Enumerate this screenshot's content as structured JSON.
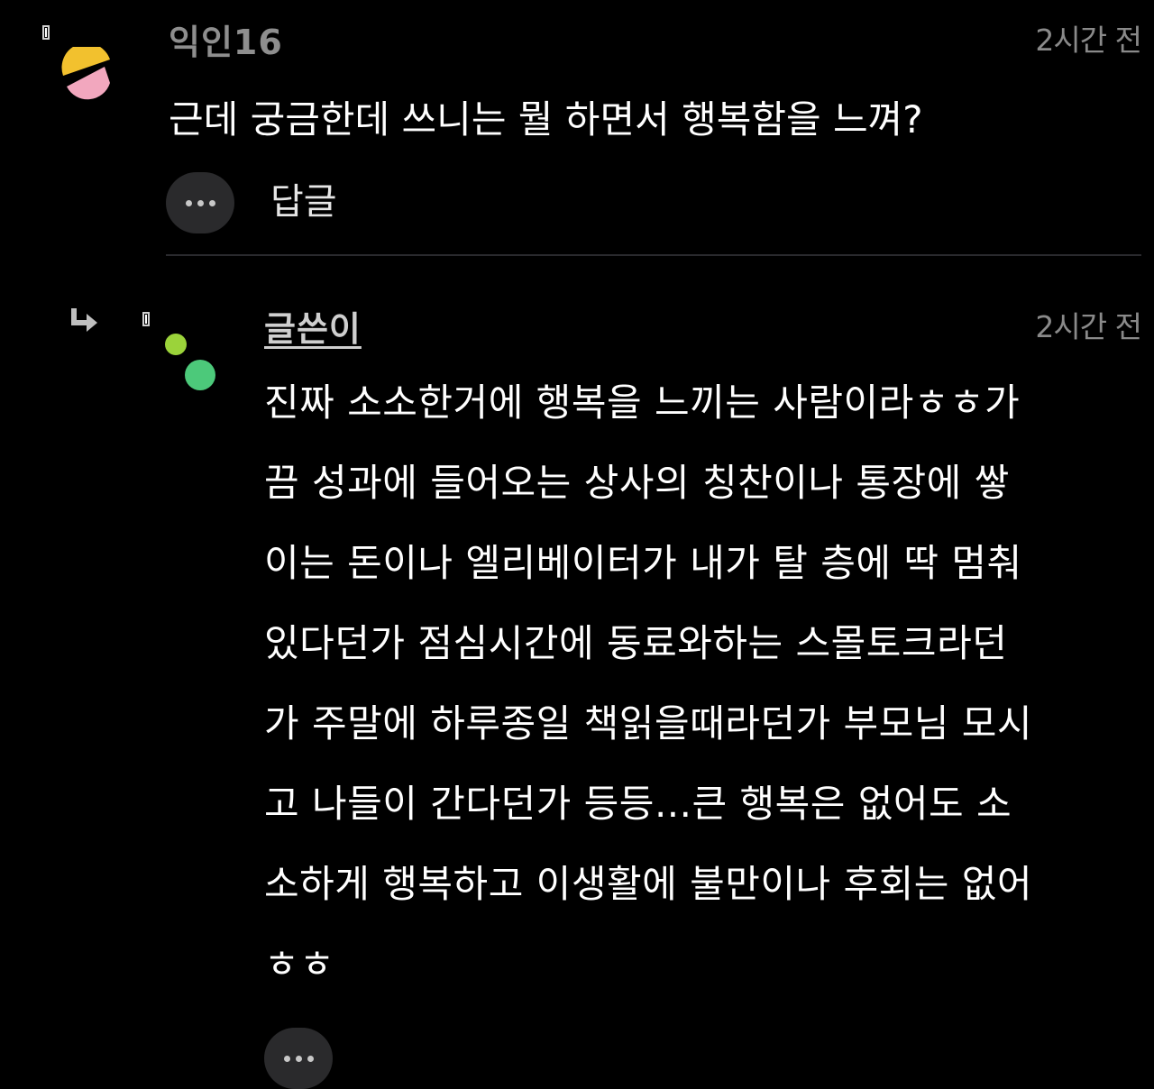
{
  "comments": [
    {
      "username": "익인16",
      "timestamp": "2시간 전",
      "text": "근데 궁금한데 쓰니는 뭘 하면서 행복함을 느껴?",
      "reply_label": "답글"
    },
    {
      "username": "글쓴이",
      "timestamp": "2시간 전",
      "lines": [
        "진짜 소소한거에 행복을 느끼는 사람이라ㅎㅎ가",
        "끔 성과에 들어오는 상사의 칭찬이나 통장에 쌓",
        "이는 돈이나 엘리베이터가 내가 탈 층에 딱 멈춰",
        "있다던가 점심시간에 동료와하는 스몰토크라던",
        "가 주말에 하루종일 책읽을때라던가 부모님 모시",
        "고 나들이 간다던가 등등...큰 행복은 없어도 소",
        "소하게 행복하고 이생활에 불만이나 후회는 없어",
        "ㅎㅎ"
      ]
    }
  ],
  "colors": {
    "background": "#000000",
    "username": "#8e8e8e",
    "author": "#cfcfcf",
    "timestamp": "#8a8a8a",
    "text": "#ffffff",
    "button_bg": "#2a2a2c",
    "avatar1_yellow": "#f2c12e",
    "avatar1_pink": "#f2a7be",
    "avatar2_lime": "#9bd33a",
    "avatar2_green": "#4cc97a"
  },
  "icons": [
    "checkbox-icon",
    "avatar",
    "more-icon",
    "reply-arrow-icon"
  ]
}
